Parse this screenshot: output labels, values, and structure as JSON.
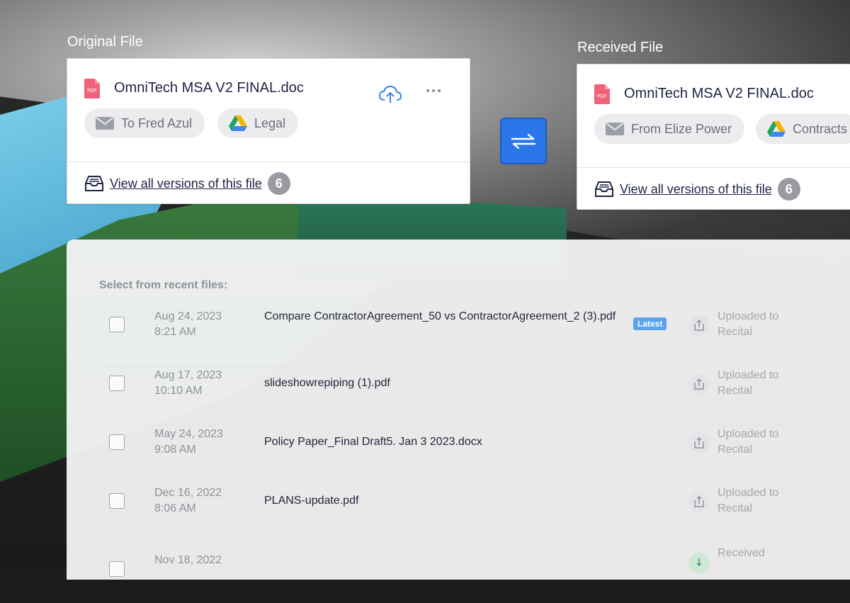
{
  "original": {
    "label": "Original File",
    "file_name": "OmniTech MSA V2 FINAL.doc",
    "chips": [
      "To Fred Azul",
      "Legal"
    ],
    "versions_link": "View all versions of this file",
    "versions_count": "6"
  },
  "received": {
    "label": "Received File",
    "file_name": "OmniTech MSA V2 FINAL.doc",
    "chips": [
      "From Elize Power",
      "Contracts"
    ],
    "versions_link": "View all versions of this file",
    "versions_count": "6"
  },
  "recent": {
    "heading": "Select from recent files:",
    "latest_badge": "Latest",
    "rows": [
      {
        "date": "Aug 24, 2023",
        "time": "8:21 AM",
        "name": "Compare ContractorAgreement_50 vs ContractorAgreement_2 (3).pdf",
        "status": "Uploaded to Recital"
      },
      {
        "date": "Aug 17, 2023",
        "time": "10:10 AM",
        "name": "slideshowrepiping (1).pdf",
        "status": "Uploaded to Recital"
      },
      {
        "date": "May 24, 2023",
        "time": "9:08 AM",
        "name": "Policy Paper_Final Draft5. Jan 3 2023.docx",
        "status": "Uploaded to Recital"
      },
      {
        "date": "Dec 16, 2022",
        "time": "8:06 AM",
        "name": "PLANS-update.pdf",
        "status": "Uploaded to Recital"
      },
      {
        "date": "Nov 18, 2022",
        "time": "",
        "name": "",
        "status": "Received"
      }
    ]
  },
  "colors": {
    "accent": "#2b77ea",
    "pdf_red": "#f0627a",
    "latest_badge": "#5ba4ec"
  }
}
